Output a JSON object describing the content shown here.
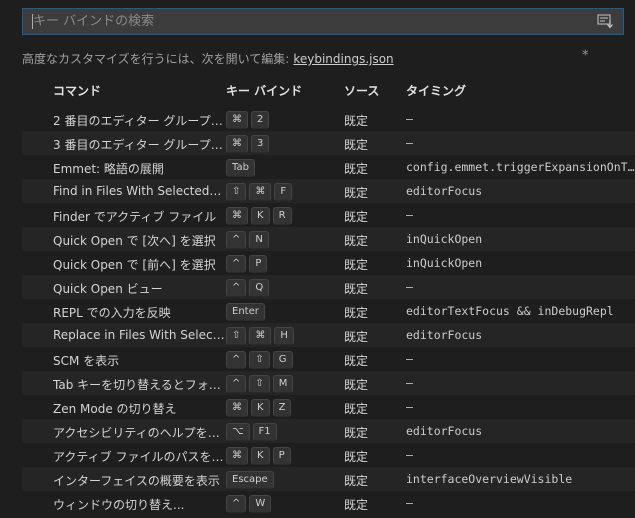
{
  "search": {
    "placeholder": "キー バインドの検索"
  },
  "hint": {
    "text": "高度なカスタマイズを行うには、次を開いて編集:",
    "link": "keybindings.json"
  },
  "header": {
    "command": "コマンド",
    "keybinding": "キー バインド",
    "source": "ソース",
    "when": "タイミング"
  },
  "rows": [
    {
      "command": "2 番目のエディター グループ…",
      "keys": [
        "⌘",
        "2"
      ],
      "source": "既定",
      "when": "—"
    },
    {
      "command": "3 番目のエディター グループ…",
      "keys": [
        "⌘",
        "3"
      ],
      "source": "既定",
      "when": "—"
    },
    {
      "command": "Emmet: 略語の展開",
      "keys": [
        "Tab"
      ],
      "source": "既定",
      "when": "config.emmet.triggerExpansionOnTab"
    },
    {
      "command": "Find in Files With Selected Text",
      "keys": [
        "⇧",
        "⌘",
        "F"
      ],
      "source": "既定",
      "when": "editorFocus"
    },
    {
      "command": "Finder でアクティブ ファイル",
      "keys": [
        "⌘",
        "K",
        "R"
      ],
      "source": "既定",
      "when": "—"
    },
    {
      "command": "Quick Open で [次へ] を選択",
      "keys": [
        "^",
        "N"
      ],
      "source": "既定",
      "when": "inQuickOpen"
    },
    {
      "command": "Quick Open で [前へ] を選択",
      "keys": [
        "^",
        "P"
      ],
      "source": "既定",
      "when": "inQuickOpen"
    },
    {
      "command": "Quick Open ビュー",
      "keys": [
        "^",
        "Q"
      ],
      "source": "既定",
      "when": "—"
    },
    {
      "command": "REPL での入力を反映",
      "keys": [
        "Enter"
      ],
      "source": "既定",
      "when": "editorTextFocus && inDebugRepl"
    },
    {
      "command": "Replace in Files With Selected Text",
      "keys": [
        "⇧",
        "⌘",
        "H"
      ],
      "source": "既定",
      "when": "editorFocus"
    },
    {
      "command": "SCM を表示",
      "keys": [
        "^",
        "⇧",
        "G"
      ],
      "source": "既定",
      "when": "—"
    },
    {
      "command": "Tab キーを切り替えるとフォーカス移動",
      "keys": [
        "^",
        "⇧",
        "M"
      ],
      "source": "既定",
      "when": "—"
    },
    {
      "command": "Zen Mode の切り替え",
      "keys": [
        "⌘",
        "K",
        "Z"
      ],
      "source": "既定",
      "when": "—"
    },
    {
      "command": "アクセシビリティのヘルプを表示",
      "keys": [
        "⌥",
        "F1"
      ],
      "source": "既定",
      "when": "editorFocus"
    },
    {
      "command": "アクティブ ファイルのパスをコピー",
      "keys": [
        "⌘",
        "K",
        "P"
      ],
      "source": "既定",
      "when": "—"
    },
    {
      "command": "インターフェイスの概要を表示",
      "keys": [
        "Escape"
      ],
      "source": "既定",
      "when": "interfaceOverviewVisible"
    },
    {
      "command": "ウィンドウの切り替え...",
      "keys": [
        "^",
        "W"
      ],
      "source": "既定",
      "when": "—"
    }
  ]
}
